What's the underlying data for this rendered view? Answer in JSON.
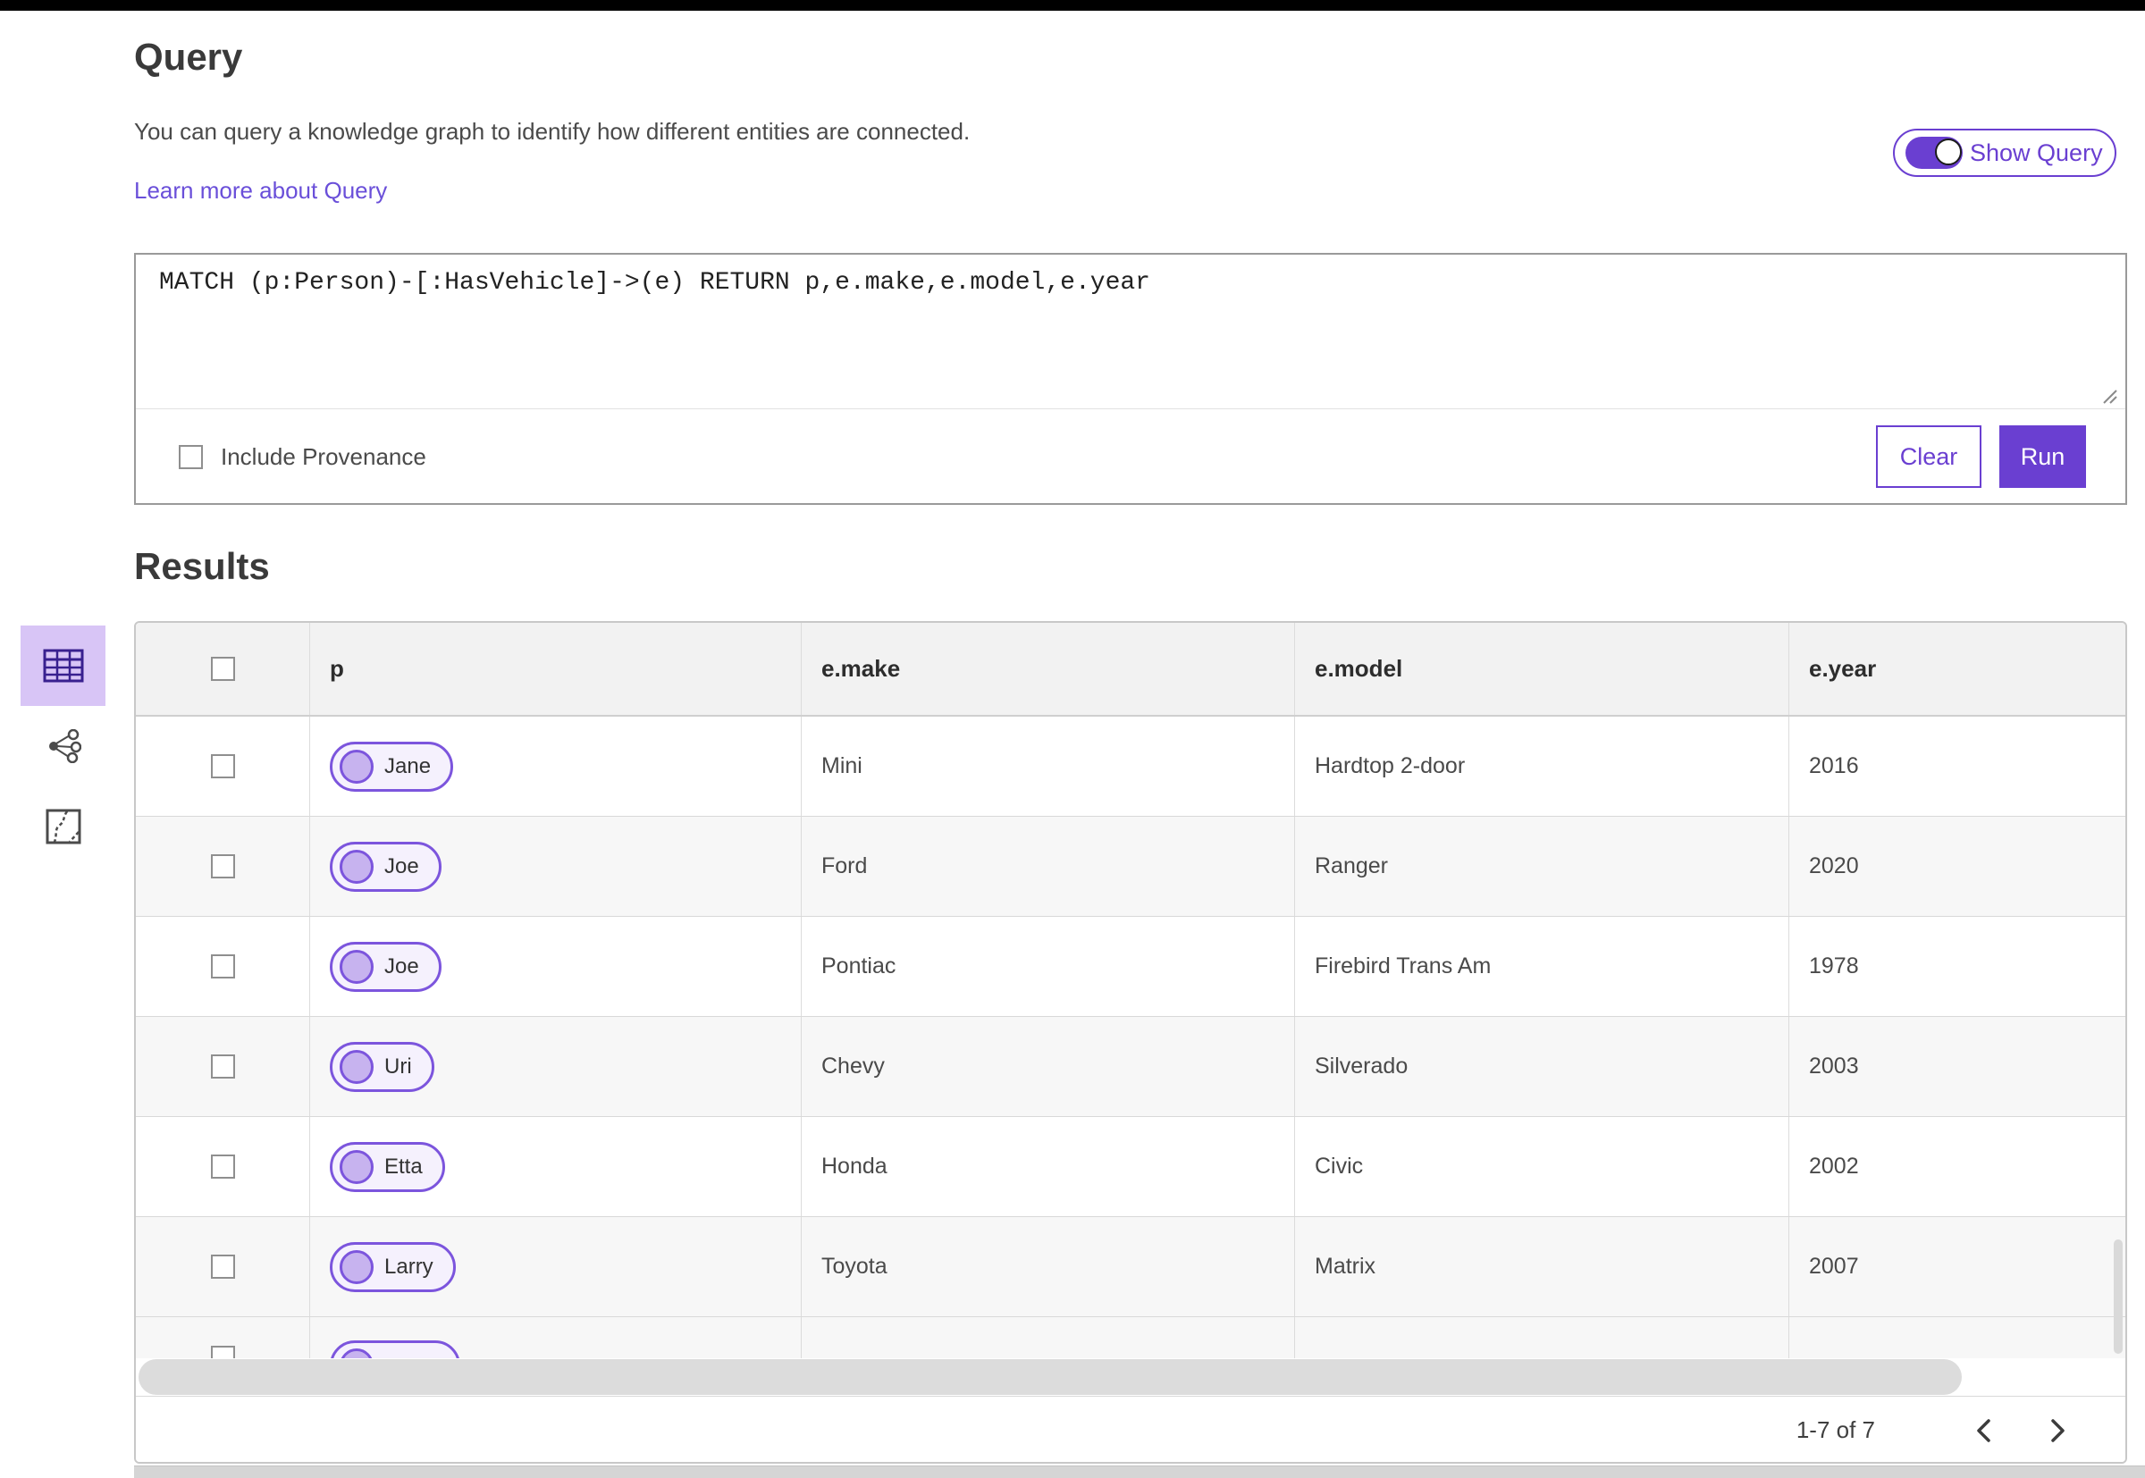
{
  "query_section": {
    "heading": "Query",
    "description": "You can query a knowledge graph to identify how different entities are connected.",
    "learn_more_link": "Learn more about Query",
    "show_query_toggle": {
      "label": "Show Query",
      "state": "on"
    },
    "editor": {
      "query_text": "MATCH (p:Person)-[:HasVehicle]->(e) RETURN p,e.make,e.model,e.year",
      "include_provenance": {
        "label": "Include Provenance",
        "checked": false
      },
      "clear_button": "Clear",
      "run_button": "Run"
    }
  },
  "results_section": {
    "heading": "Results",
    "view_switcher": [
      {
        "id": "table-view",
        "icon": "table-icon",
        "active": true
      },
      {
        "id": "link-chart-view",
        "icon": "link-chart-icon",
        "active": false
      },
      {
        "id": "map-view",
        "icon": "map-icon",
        "active": false
      }
    ],
    "table": {
      "columns": [
        "p",
        "e.make",
        "e.model",
        "e.year"
      ],
      "rows": [
        {
          "p": "Jane",
          "e_make": "Mini",
          "e_model": "Hardtop 2-door",
          "e_year": "2016"
        },
        {
          "p": "Joe",
          "e_make": "Ford",
          "e_model": "Ranger",
          "e_year": "2020"
        },
        {
          "p": "Joe",
          "e_make": "Pontiac",
          "e_model": "Firebird Trans Am",
          "e_year": "1978"
        },
        {
          "p": "Uri",
          "e_make": "Chevy",
          "e_model": "Silverado",
          "e_year": "2003"
        },
        {
          "p": "Etta",
          "e_make": "Honda",
          "e_model": "Civic",
          "e_year": "2002"
        },
        {
          "p": "Larry",
          "e_make": "Toyota",
          "e_model": "Matrix",
          "e_year": "2007"
        }
      ],
      "partially_visible_row": true
    },
    "pagination": {
      "range_label": "1-7 of 7",
      "prev_icon": "chevron-left-icon",
      "next_icon": "chevron-right-icon"
    }
  },
  "colors": {
    "accent_purple": "#6a3fd1",
    "link_purple": "#6a4fd9",
    "active_view_bg": "#d8c5f6",
    "active_icon_purple": "#38208f",
    "pill_border": "#7c55dd",
    "pill_bg": "#f5f1fd",
    "pill_dot_fill": "#c7b3ef",
    "header_bg": "#f2f2f2",
    "row_alt_bg": "#f7f7f7"
  }
}
